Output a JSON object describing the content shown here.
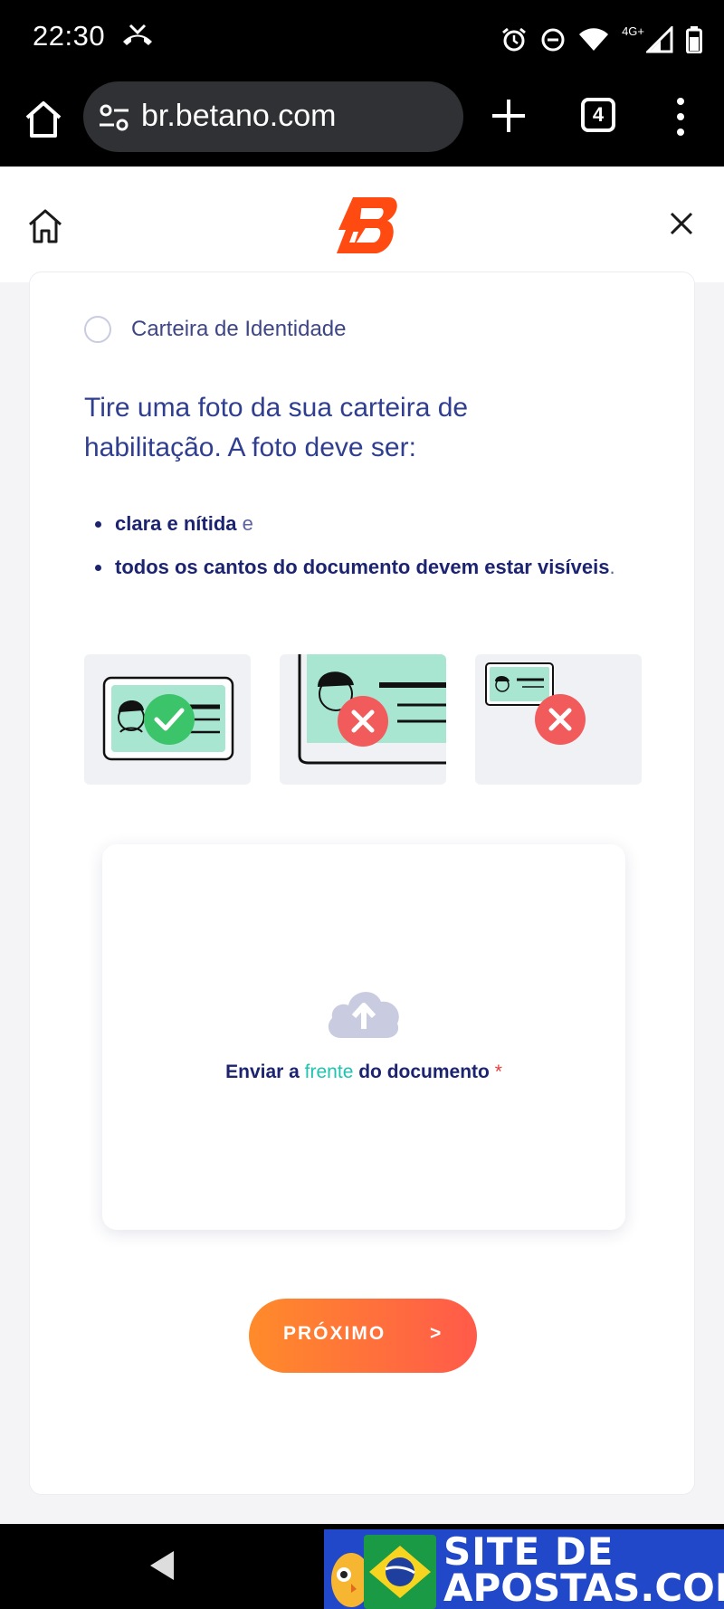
{
  "status_bar": {
    "time": "22:30",
    "network": "4G+",
    "icons": [
      "missed-call-icon",
      "alarm-icon",
      "do-not-disturb-icon",
      "wifi-icon",
      "signal-icon",
      "battery-icon"
    ]
  },
  "browser": {
    "url": "br.betano.com",
    "tab_count": "4",
    "icons": [
      "home-icon",
      "site-settings-icon",
      "new-tab-icon",
      "tab-switcher-icon",
      "menu-icon"
    ]
  },
  "app_header": {
    "logo": "betano-logo",
    "icons": [
      "home-icon",
      "close-icon"
    ]
  },
  "form": {
    "radio_option": "Carteira de Identidade",
    "instruction": "Tire uma foto da sua carteira de habilitação. A foto deve ser:",
    "bullets": [
      {
        "bold": "clara e nítida",
        "rest": " e"
      },
      {
        "bold": "todos os cantos do documento devem estar visíveis",
        "rest": "."
      }
    ],
    "upload": {
      "prefix": "Enviar a ",
      "highlight": "frente",
      "suffix": " do documento ",
      "required_mark": "*"
    },
    "next_button": {
      "label": "PRÓXIMO",
      "arrow": ">"
    }
  },
  "watermark": {
    "line1": "SITE DE",
    "line2": "APOSTAS.COM"
  },
  "colors": {
    "brand_orange": "#ff5a1f",
    "accent_teal": "#1fc4b0",
    "text_navy": "#1c2470",
    "ok_green": "#3cc46a",
    "error_red": "#f25b5b"
  }
}
